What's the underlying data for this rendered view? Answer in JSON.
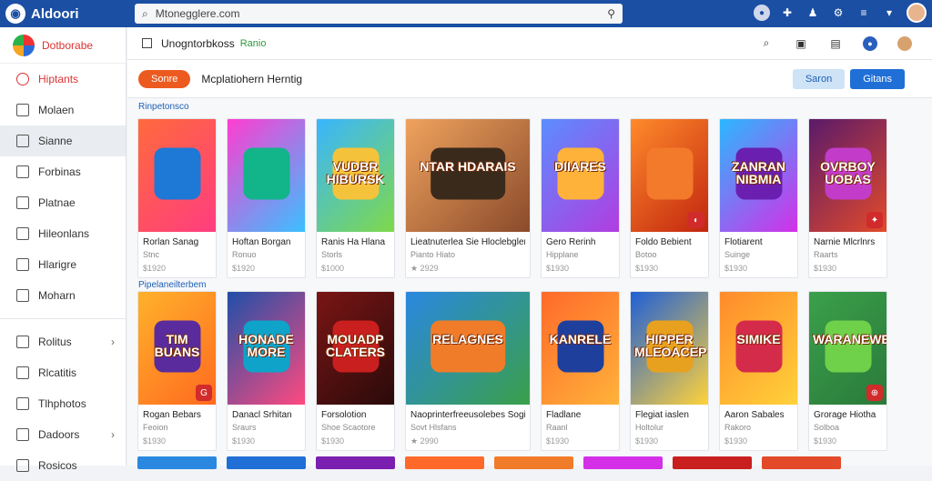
{
  "app": {
    "title": "Aldoori",
    "url": "Mtonegglere.com"
  },
  "sidebar": {
    "header": "Dotborabe",
    "items": [
      {
        "label": "Hiptants",
        "icon": "target-icon",
        "style": "red"
      },
      {
        "label": "Molaen",
        "icon": "folder-icon"
      },
      {
        "label": "Sianne",
        "icon": "pen-icon",
        "active": true
      },
      {
        "label": "Forbinas",
        "icon": "calendar-icon"
      },
      {
        "label": "Platnae",
        "icon": "square-icon"
      },
      {
        "label": "Hileonlans",
        "icon": "grid-icon"
      },
      {
        "label": "Hlarigre",
        "icon": "leaf-icon"
      },
      {
        "label": "Moharn",
        "icon": "shield-icon"
      }
    ],
    "items2": [
      {
        "label": "Rolitus",
        "icon": "tag-icon",
        "chevron": true
      },
      {
        "label": "Rlcatitis",
        "icon": "book-icon"
      },
      {
        "label": "Tlhphotos",
        "icon": "info-icon"
      },
      {
        "label": "Dadoors",
        "icon": "pin-icon",
        "chevron": true
      },
      {
        "label": "Rosicos",
        "icon": "box-icon"
      }
    ]
  },
  "toolbar": {
    "label": "Unogntorbkoss",
    "tag": "Ranio"
  },
  "filter": {
    "pill": "Sonre",
    "label": "Mcplatiohern Herntig",
    "btn_light": "Saron",
    "btn_dark": "Gitans"
  },
  "sections": [
    "Rinpetonsco",
    "Pipelaneilterbem"
  ],
  "row1": [
    {
      "name": "Rorlan Sanag",
      "sub": "Stnc",
      "price": "$1920",
      "title": "",
      "colors": [
        "#ff6a3d",
        "#ff3d7f"
      ],
      "art": "#1e78d6",
      "badge": ""
    },
    {
      "name": "Hoftan Borgan",
      "sub": "Ronuo",
      "price": "$1920",
      "title": "",
      "colors": [
        "#ff3dd0",
        "#3ac0ff"
      ],
      "art": "#12b48a",
      "badge": ""
    },
    {
      "name": "Ranis Ha Hlana",
      "sub": "Storls",
      "price": "$1000",
      "title": "VUDBR HIBURSK",
      "colors": [
        "#39b5ff",
        "#7fd94a"
      ],
      "art": "#f5c33b",
      "badge": ""
    },
    {
      "name": "Lieatnuterlea Sie Hloclebgler",
      "sub": "Pianto Hiato",
      "price": "★ 2929",
      "title": "NTAR HDARAIS",
      "colors": [
        "#f0a35e",
        "#8a4a2b"
      ],
      "art": "#3a2a1c",
      "badge": "",
      "wide": true
    },
    {
      "name": "Gero Rerinh",
      "sub": "Hipplane",
      "price": "$1930",
      "title": "DIIARES",
      "colors": [
        "#5b8dff",
        "#b13de0"
      ],
      "art": "#ffb23a",
      "badge": ""
    },
    {
      "name": "Foldo Bebient",
      "sub": "Botoo",
      "price": "$1930",
      "title": "",
      "colors": [
        "#ff8a2b",
        "#c2260f"
      ],
      "art": "#f27a2a",
      "badge": "◐"
    },
    {
      "name": "Flotiarent",
      "sub": "Suinge",
      "price": "$1930",
      "title": "ZANRAN NIBMIA",
      "colors": [
        "#2bb8ff",
        "#d330e8"
      ],
      "art": "#6a1fb0",
      "badge": ""
    },
    {
      "name": "Narnie Mlcrlnrs",
      "sub": "Raarts",
      "price": "$1930",
      "title": "OVRBOY UOBAS",
      "colors": [
        "#5a1a6a",
        "#e24a2a"
      ],
      "art": "#c23cc9",
      "badge": "✦"
    }
  ],
  "row2": [
    {
      "name": "Rogan Bebars",
      "sub": "Feoion",
      "price": "$1930",
      "title": "TIM BUANS",
      "colors": [
        "#ffb12b",
        "#ff6a1f"
      ],
      "art": "#5a2b9c",
      "badge": "G"
    },
    {
      "name": "Danacl Srhitan",
      "sub": "Sraurs",
      "price": "$1930",
      "title": "HONADE MORE",
      "colors": [
        "#1f4fa8",
        "#ff4a7f"
      ],
      "art": "#0fa3c9",
      "badge": ""
    },
    {
      "name": "Forsolotion",
      "sub": "Shoe Scaotore",
      "price": "$1930",
      "title": "MOUADP CLATERS",
      "colors": [
        "#7a1515",
        "#2a0a0a"
      ],
      "art": "#c91f1f",
      "badge": ""
    },
    {
      "name": "Naoprinterfreeusolebes Sogilne",
      "sub": "Sovt Hlsfans",
      "price": "★ 2990",
      "title": "RELAGNES",
      "colors": [
        "#2a88e0",
        "#3aa04a"
      ],
      "art": "#f07c2a",
      "badge": "",
      "wide": true
    },
    {
      "name": "Fladlane",
      "sub": "Raanl",
      "price": "$1930",
      "title": "KANRELE",
      "colors": [
        "#ff6a2a",
        "#ffb23a"
      ],
      "art": "#1f3f9c",
      "badge": ""
    },
    {
      "name": "Flegiat iaslen",
      "sub": "Holtolur",
      "price": "$1930",
      "title": "HIPPER MLEOACEP",
      "colors": [
        "#1f5fd6",
        "#ffd23a"
      ],
      "art": "#e8a11f",
      "badge": ""
    },
    {
      "name": "Aaron Sabales",
      "sub": "Rakoro",
      "price": "$1930",
      "title": "SIMIKE",
      "colors": [
        "#ff8a2b",
        "#ffd23a"
      ],
      "art": "#d42b4a",
      "badge": ""
    },
    {
      "name": "Grorage Hiotha",
      "sub": "Solboa",
      "price": "$1930",
      "title": "WARANEWE",
      "colors": [
        "#3aa04a",
        "#2a7a3a"
      ],
      "art": "#6fd04a",
      "badge": "⊕"
    }
  ],
  "row3_colors": [
    "#2a88e0",
    "#1f6fd6",
    "#7a1fb0",
    "#ff6a2a",
    "#f07c2a",
    "#d330e8",
    "#c91f1f",
    "#e24a2a"
  ]
}
